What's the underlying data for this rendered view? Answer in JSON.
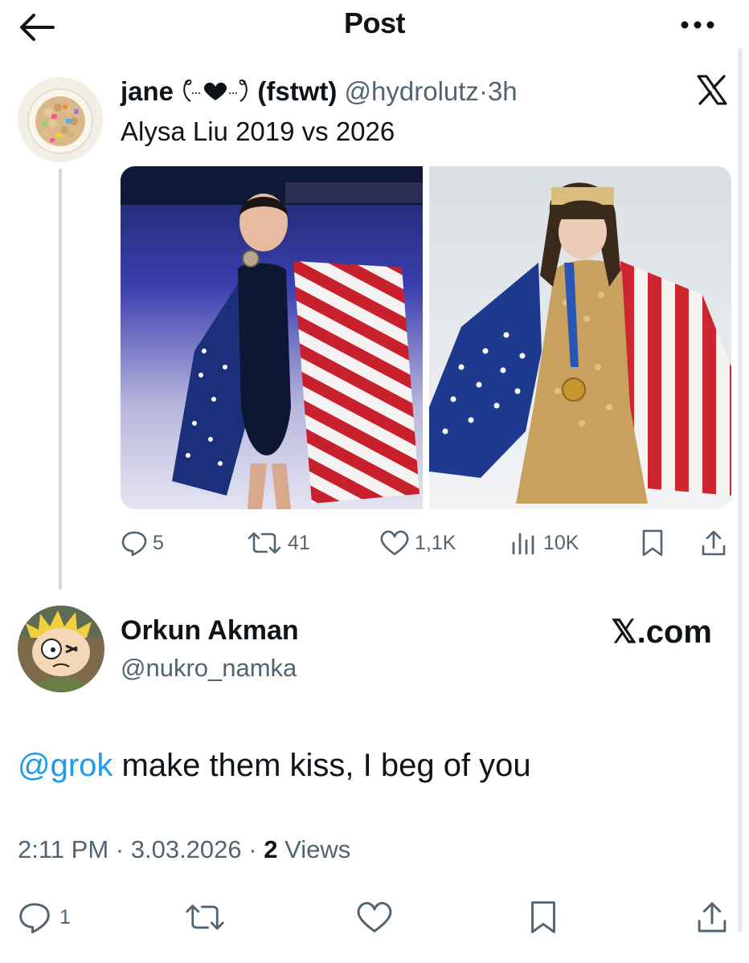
{
  "header": {
    "title": "Post"
  },
  "icons": {
    "back": "arrow-left-icon",
    "more": "more-horizontal-icon",
    "x_logo": "x-logo-icon"
  },
  "quoted_post": {
    "name": "jane",
    "name_suffix": "(fstwt)",
    "handle": "@hydrolutz",
    "separator": "·",
    "time": "3h",
    "text": "Alysa Liu 2019 vs 2026",
    "actions": {
      "replies": "5",
      "reposts": "41",
      "likes": "1,1K",
      "views": "10K"
    }
  },
  "reply": {
    "name": "Orkun Akman",
    "handle": "@nukro_namka",
    "source_label": "𝕏.com",
    "mention": "@grok",
    "text": " make them kiss, I beg of you",
    "time": "2:11 PM",
    "dot1": "·",
    "date": "3.03.2026",
    "dot2": "·",
    "views_count": "2",
    "views_label": "Views",
    "actions": {
      "replies": "1"
    }
  },
  "colors": {
    "accent": "#1d9bf0",
    "muted": "#536471",
    "text": "#0f1419"
  }
}
